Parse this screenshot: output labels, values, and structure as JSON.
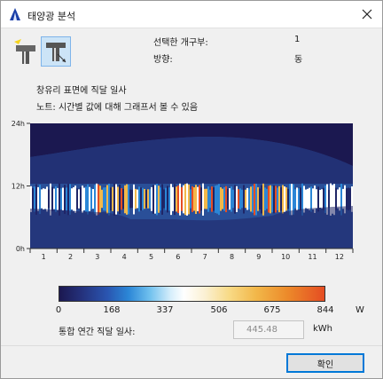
{
  "window": {
    "title": "태양광 분석"
  },
  "toolbar": {
    "tool_a_icon": "sun-window-icon",
    "tool_b_icon": "sun-window-opening-icon"
  },
  "info": {
    "selected_label": "선택한 개구부:",
    "selected_value": "1",
    "direction_label": "방향:",
    "direction_value": "동"
  },
  "notes": {
    "line1": "창유리 표면에 직달 일사",
    "line2": "노트: 시간별 값에 대해 그래프서 볼 수 있음"
  },
  "chart_data": {
    "type": "heatmap",
    "y_ticks": [
      "24h",
      "12h",
      "0h"
    ],
    "ylim": [
      0,
      24
    ],
    "x_ticks": [
      "1",
      "2",
      "3",
      "4",
      "5",
      "6",
      "7",
      "8",
      "9",
      "10",
      "11",
      "12"
    ],
    "colorbar": {
      "ticks": [
        "0",
        "168",
        "337",
        "506",
        "675",
        "844"
      ],
      "min": 0,
      "max": 844,
      "unit": "W"
    },
    "colors": {
      "background": "#2a4f98",
      "night": "#1b1850",
      "edge": "#1f2566",
      "low": "#2b86d6",
      "mid": "#ffffff",
      "high": "#f2b84a",
      "peak": "#e54d23"
    }
  },
  "total": {
    "label": "통합 연간 직달 일사:",
    "value": "445.48",
    "unit": "kWh"
  },
  "footer": {
    "ok_label": "확인"
  }
}
